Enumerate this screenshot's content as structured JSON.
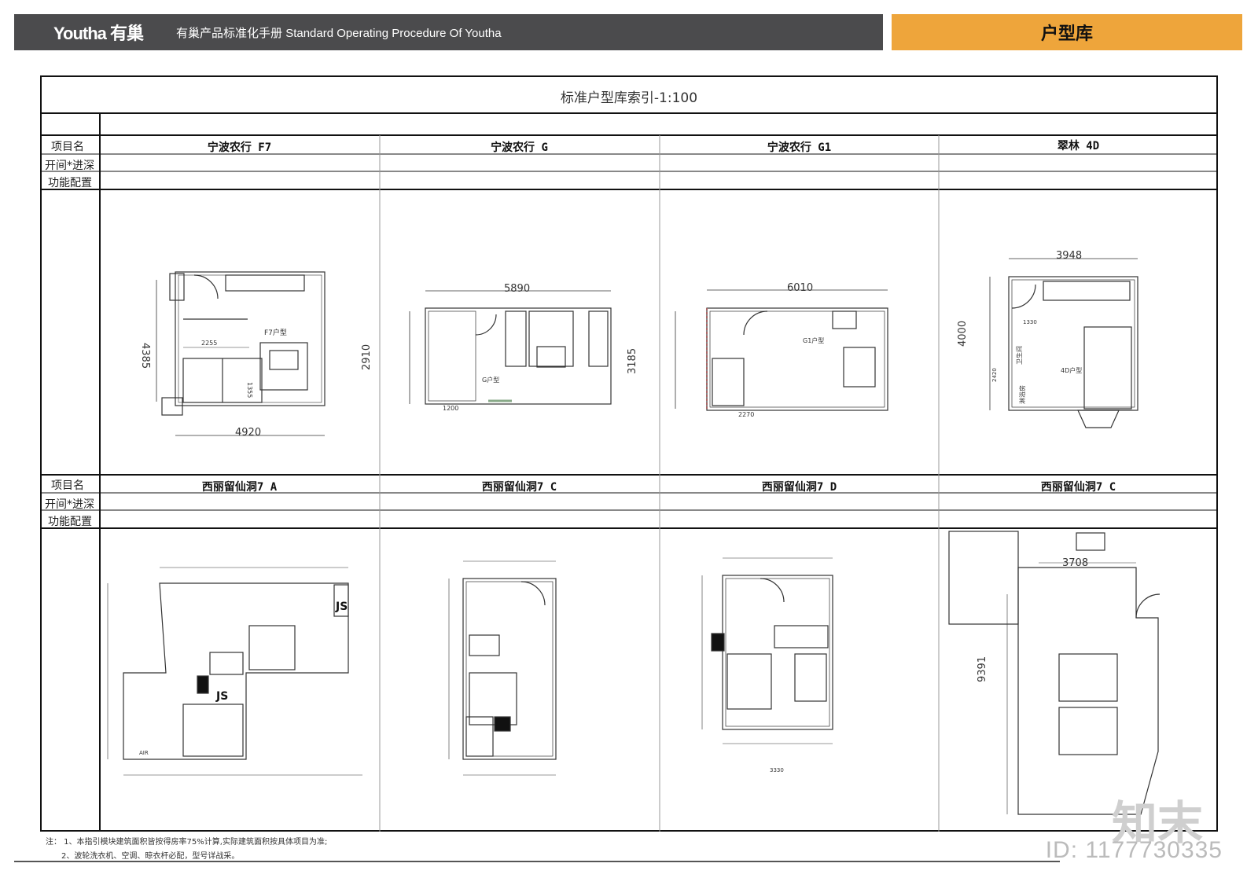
{
  "header": {
    "logo": "Youtha 有巢",
    "subtitle": "有巢产品标准化手册 Standard Operating Procedure Of Youtha",
    "section": "户型库"
  },
  "table": {
    "title": "标准户型库索引-1:100",
    "row_labels": {
      "project": "项目名",
      "width_depth": "开间*进深",
      "function": "功能配置"
    },
    "row1": [
      {
        "name": "宁波农行  F7",
        "plan_label": "F7户型",
        "dim_w": "4920",
        "dim_h": "4385",
        "dim_inner": "2255",
        "dim_small": "1355"
      },
      {
        "name": "宁波农行  G",
        "plan_label": "G户型",
        "dim_w": "5890",
        "dim_h": "2910",
        "dim_inner": "1200"
      },
      {
        "name": "宁波农行  G1",
        "plan_label": "G1户型",
        "dim_w": "6010",
        "dim_h": "3185",
        "dim_inner": "2270"
      },
      {
        "name": "翠林  4D",
        "plan_label": "4D户型",
        "dim_w": "3948",
        "dim_h": "4000",
        "dim_inner": "1330",
        "dim_small": "2420",
        "room1": "卫生间",
        "room2": "淋浴房"
      }
    ],
    "row2": [
      {
        "name": "西丽留仙洞7  A",
        "tag1": "JS",
        "tag2": "JS",
        "tag3": "AIR"
      },
      {
        "name": "西丽留仙洞7  C"
      },
      {
        "name": "西丽留仙洞7  D",
        "dim_w": "3330"
      },
      {
        "name": "西丽留仙洞7  C",
        "dim_w": "3708",
        "dim_h": "9391"
      }
    ]
  },
  "notes": [
    "注：  1、本指引模块建筑面积皆按得房率75%计算,实际建筑面积按具体项目为准;",
    "2、波轮洗衣机、空调、晾衣杆必配，型号详战采。"
  ],
  "watermark": {
    "brand": "知末",
    "id": "ID: 1177730335"
  }
}
